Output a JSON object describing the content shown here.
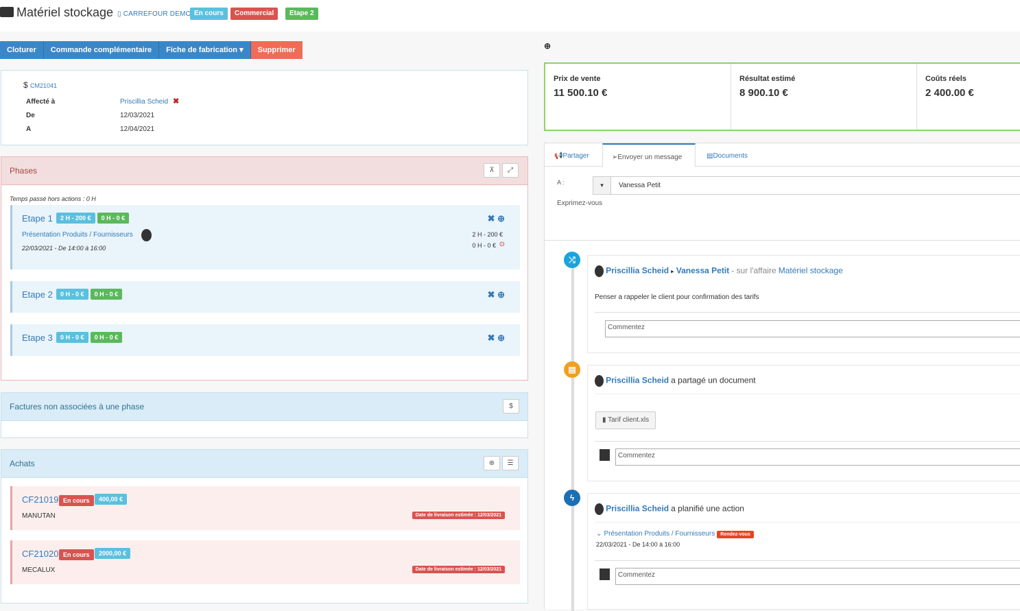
{
  "header": {
    "title": "Matériel stockage",
    "client": "CARREFOUR DEMO",
    "badges": [
      {
        "label": "En cours",
        "color": "#5bc0de"
      },
      {
        "label": "Commercial",
        "color": "#d9534f"
      },
      {
        "label": "Etape 2",
        "color": "#5cb85c"
      }
    ]
  },
  "toolbar": {
    "cloturer": "Cloturer",
    "commande": "Commande complémentaire",
    "fiche": "Fiche de fabrication",
    "supprimer": "Supprimer"
  },
  "info": {
    "ref": "CM21041",
    "currency_symbol": "$",
    "assigned_label": "Affecté à",
    "assigned_value": "Priscillia Scheid",
    "from_label": "De",
    "from_value": "12/03/2021",
    "to_label": "A",
    "to_value": "12/04/2021"
  },
  "phases": {
    "title": "Phases",
    "time_outside": "Temps passé hors actions : 0 H",
    "items": [
      {
        "name": "Etape 1",
        "planned": "2 H - 200 €",
        "actual": "0 H - 0 €",
        "task": "Présentation Produits / Fournisseurs",
        "task_date": "22/03/2021 - De 14:00 à 16:00",
        "task_planned": "2 H - 200 €",
        "task_actual": "0 H - 0 €"
      },
      {
        "name": "Etape 2",
        "planned": "0 H - 0 €",
        "actual": "0 H - 0 €"
      },
      {
        "name": "Etape 3",
        "planned": "0 H - 0 €",
        "actual": "0 H - 0 €"
      }
    ]
  },
  "factures": {
    "title": "Factures non associées à une phase",
    "btn": "$"
  },
  "achats": {
    "title": "Achats",
    "items": [
      {
        "ref": "CF21019",
        "status": "En cours",
        "amount": "400,00 €",
        "supplier": "MANUTAN",
        "delivery": "Date de livraison estimée : 12/03/2021"
      },
      {
        "ref": "CF21020",
        "status": "En cours",
        "amount": "2000,00 €",
        "supplier": "MECALUX",
        "delivery": "Date de livraison estimée : 12/03/2021"
      }
    ]
  },
  "kpis": [
    {
      "label": "Prix de vente",
      "value": "11 500.10 €"
    },
    {
      "label": "Résultat estimé",
      "value": "8 900.10 €"
    },
    {
      "label": "Coûts réels",
      "value": "2 400.00 €"
    }
  ],
  "feed": {
    "tabs": [
      "Partager",
      "Envoyer un message",
      "Documents"
    ],
    "to_label": "A :",
    "to_value": "Vanessa Petit",
    "express": "Exprimez-vous",
    "comment_placeholder": "Commentez",
    "entries": [
      {
        "author": "Priscillia Scheid",
        "target": "Vanessa Petit",
        "context": "- sur l'affaire",
        "affaire": "Matériel stockage",
        "message": "Penser a rappeler le client pour confirmation des tarifs"
      },
      {
        "author": "Priscillia Scheid",
        "action": "a partagé un document",
        "document": "Tarif client.xls"
      },
      {
        "author": "Priscillia Scheid",
        "action": "a planifié une action",
        "task": "Présentation Produits / Fournisseurs",
        "task_badge": "Rendez-vous",
        "task_date": "22/03/2021 - De 14:00 à 16:00"
      }
    ]
  }
}
